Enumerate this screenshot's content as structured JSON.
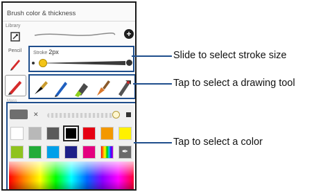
{
  "panel": {
    "title": "Brush color & thickness",
    "library_label": "Library",
    "pencil_label": "Pencil",
    "stroke_label": "Stroke",
    "stroke_value": "2px",
    "stroke_level_fraction": 0.02,
    "selection_label": "Mass"
  },
  "tools": [
    {
      "icon": "fountain-pen-icon"
    },
    {
      "icon": "ballpoint-pen-icon"
    },
    {
      "icon": "highlighter-icon"
    },
    {
      "icon": "paintbrush-icon"
    },
    {
      "icon": "airbrush-icon"
    }
  ],
  "colors": {
    "current": "#6e6e6e",
    "opacity_fraction": 0.95,
    "swatches_row1": [
      "#ffffff",
      "#b8b8b8",
      "#5a5a5a",
      "#000000",
      "#e60012",
      "#f39800",
      "#fff100"
    ],
    "swatches_row2": [
      "#8fc31f",
      "#22ac38",
      "#00a0e9",
      "#1d2088",
      "#e4007f",
      "rainbow",
      "eyedropper"
    ],
    "selected_swatch": "#000000"
  },
  "callouts": {
    "stroke": "Slide to select stroke size",
    "tool": "Tap to select a drawing tool",
    "color": "Tap to select a color"
  },
  "accent": "#1f4e8c"
}
